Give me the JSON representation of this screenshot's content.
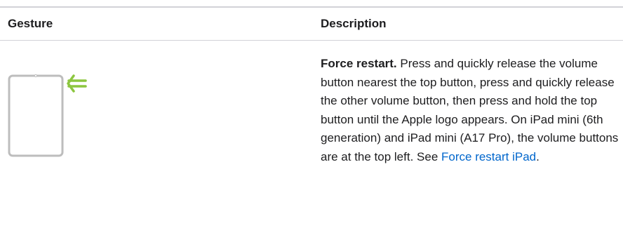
{
  "table": {
    "headers": {
      "gesture": "Gesture",
      "description": "Description"
    },
    "rows": [
      {
        "illustration": {
          "icon": "ipad-force-restart-illustration",
          "arrow_color": "#8cc63f",
          "device_outline_color": "#bdbdbd"
        },
        "lead": "Force restart.",
        "text": " Press and quickly release the volume button nearest the top button, press and quickly release the other volume button, then press and hold the top button until the Apple logo appears. On iPad mini (6th generation) and iPad mini (A17 Pro), the volume buttons are at the top left. See ",
        "link_text": "Force restart iPad",
        "trailing": "."
      }
    ]
  }
}
